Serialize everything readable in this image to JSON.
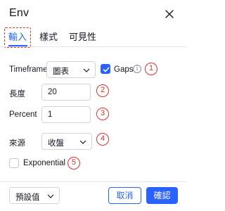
{
  "dialog": {
    "title": "Env"
  },
  "tabs": [
    {
      "label": "輸入",
      "active": true
    },
    {
      "label": "樣式",
      "active": false
    },
    {
      "label": "可見性",
      "active": false
    }
  ],
  "fields": {
    "timeframe": {
      "label": "Timeframe",
      "value": "圖表"
    },
    "gaps": {
      "label": "Gaps",
      "checked": true,
      "info_glyph": "i"
    },
    "length": {
      "label": "長度",
      "value": "20"
    },
    "percent": {
      "label": "Percent",
      "value": "1"
    },
    "source": {
      "label": "來源",
      "value": "收盤"
    },
    "exponential": {
      "label": "Exponential",
      "checked": false
    }
  },
  "annotations": [
    "1",
    "2",
    "3",
    "4",
    "5"
  ],
  "footer": {
    "defaults_label": "預設值",
    "cancel_label": "取消",
    "ok_label": "確認"
  },
  "colors": {
    "accent": "#2962ff",
    "annotation": "#e0312f",
    "border": "#d1d4dc"
  },
  "icons": {
    "close": "close-icon",
    "chevron": "chevron-down-icon",
    "check": "check-icon",
    "info": "info-icon"
  }
}
